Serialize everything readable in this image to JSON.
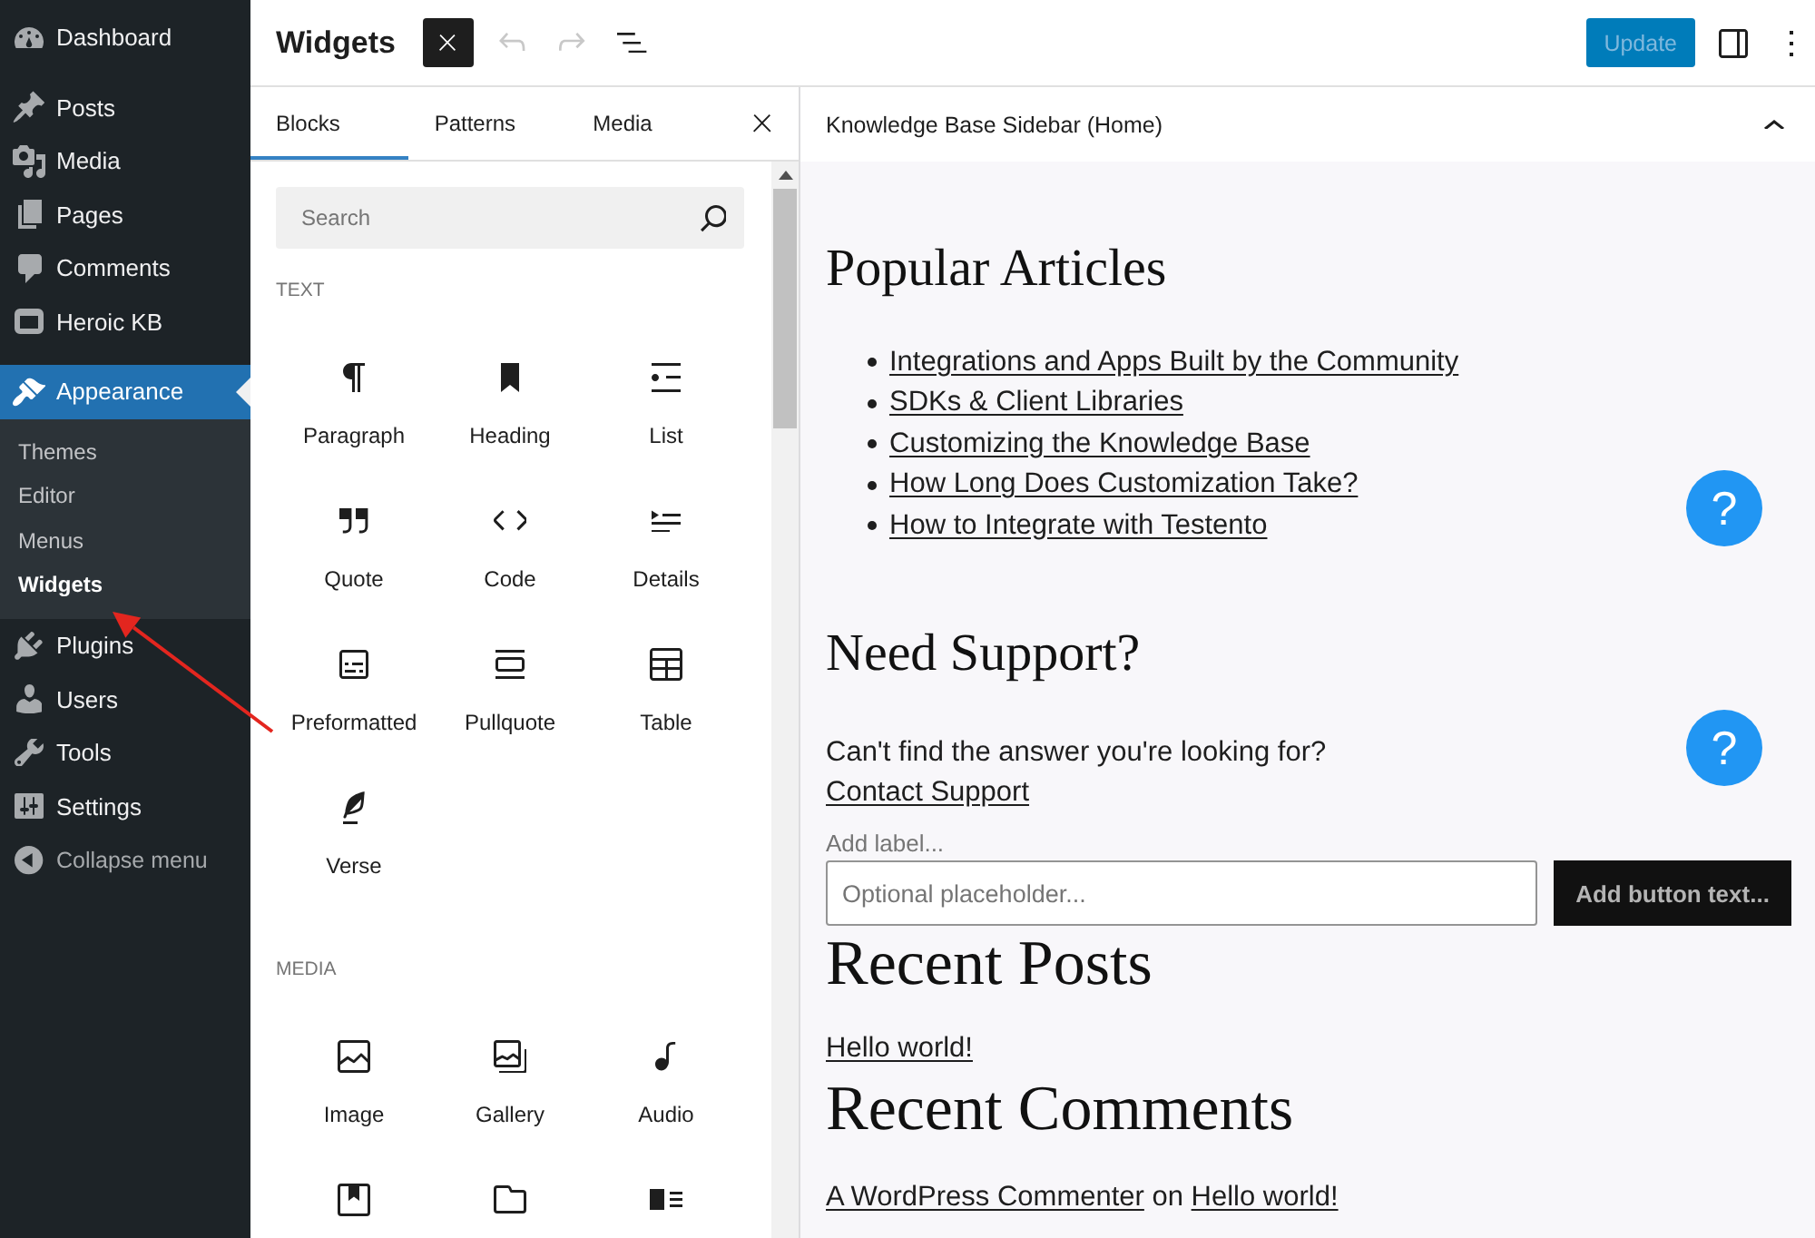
{
  "admin_menu": {
    "groups": [
      {
        "items": [
          {
            "kind": "dashboard",
            "label": "Dashboard",
            "selected": false
          }
        ]
      },
      {
        "items": [
          {
            "kind": "posts",
            "label": "Posts",
            "selected": false
          },
          {
            "kind": "media",
            "label": "Media",
            "selected": false
          },
          {
            "kind": "pages",
            "label": "Pages",
            "selected": false
          },
          {
            "kind": "comments",
            "label": "Comments",
            "selected": false
          },
          {
            "kind": "kb",
            "label": "Heroic KB",
            "selected": false
          }
        ]
      },
      {
        "items": [
          {
            "kind": "appearance",
            "label": "Appearance",
            "selected": true,
            "children": [
              {
                "label": "Themes",
                "selected": false
              },
              {
                "label": "Editor",
                "selected": false
              },
              {
                "label": "Menus",
                "selected": false
              },
              {
                "label": "Widgets",
                "selected": true
              }
            ]
          },
          {
            "kind": "plugins",
            "label": "Plugins",
            "selected": false
          },
          {
            "kind": "users",
            "label": "Users",
            "selected": false
          },
          {
            "kind": "tools",
            "label": "Tools",
            "selected": false
          },
          {
            "kind": "settings",
            "label": "Settings",
            "selected": false
          }
        ]
      }
    ],
    "collapse": {
      "label": "Collapse menu"
    }
  },
  "header": {
    "title": "Widgets",
    "tools": [
      {
        "kind": "inserter",
        "pressed": true,
        "disabled": false
      },
      {
        "kind": "undo",
        "pressed": false,
        "disabled": true
      },
      {
        "kind": "redo",
        "pressed": false,
        "disabled": true
      },
      {
        "kind": "listview",
        "pressed": false,
        "disabled": false
      }
    ],
    "update_button": {
      "label": "Update",
      "disabled": true
    },
    "actions": [
      {
        "kind": "sidebar",
        "pressed": false
      },
      {
        "kind": "more",
        "pressed": false
      }
    ]
  },
  "inserter": {
    "tabs": [
      {
        "label": "Blocks",
        "selected": true
      },
      {
        "label": "Patterns",
        "selected": false
      },
      {
        "label": "Media",
        "selected": false
      }
    ],
    "search": {
      "placeholder": "Search"
    },
    "categories": [
      {
        "title": "TEXT",
        "blocks": [
          {
            "kind": "paragraph",
            "label": "Paragraph"
          },
          {
            "kind": "heading",
            "label": "Heading"
          },
          {
            "kind": "list",
            "label": "List"
          },
          {
            "kind": "quote",
            "label": "Quote"
          },
          {
            "kind": "code",
            "label": "Code"
          },
          {
            "kind": "details",
            "label": "Details"
          },
          {
            "kind": "preformatted",
            "label": "Preformatted"
          },
          {
            "kind": "pullquote",
            "label": "Pullquote"
          },
          {
            "kind": "table",
            "label": "Table"
          },
          {
            "kind": "verse",
            "label": "Verse"
          }
        ]
      },
      {
        "title": "MEDIA",
        "blocks": [
          {
            "kind": "image",
            "label": "Image"
          },
          {
            "kind": "gallery",
            "label": "Gallery"
          },
          {
            "kind": "audio",
            "label": "Audio"
          },
          {
            "kind": "cover"
          },
          {
            "kind": "file"
          },
          {
            "kind": "mediatext"
          }
        ]
      }
    ]
  },
  "canvas": {
    "area": {
      "title": "Knowledge Base Sidebar (Home)",
      "expanded": true
    },
    "widgets": [
      {
        "kind": "list",
        "heading": "Popular Articles",
        "links": [
          "Integrations and Apps Built by the Community",
          "SDKs & Client Libraries",
          "Customizing the Knowledge Base",
          "How Long Does Customization Take?",
          "How to Integrate with Testento"
        ],
        "help_button": {
          "label": "?"
        }
      },
      {
        "kind": "text",
        "heading": "Need Support?",
        "text": "Can't find the answer you're looking for?",
        "link": "Contact Support",
        "help_button": {
          "label": "?"
        }
      },
      {
        "kind": "search",
        "label": "Add label...",
        "placeholder": "Optional placeholder...",
        "button": "Add button text..."
      },
      {
        "kind": "posts",
        "heading": "Recent Posts",
        "links": [
          "Hello world!"
        ]
      },
      {
        "kind": "comments",
        "heading": "Recent Comments",
        "comments": [
          {
            "author": "A WordPress Commenter",
            "joiner": "on",
            "post": "Hello world!"
          }
        ]
      }
    ]
  },
  "annotation": {
    "kind": "arrow"
  }
}
